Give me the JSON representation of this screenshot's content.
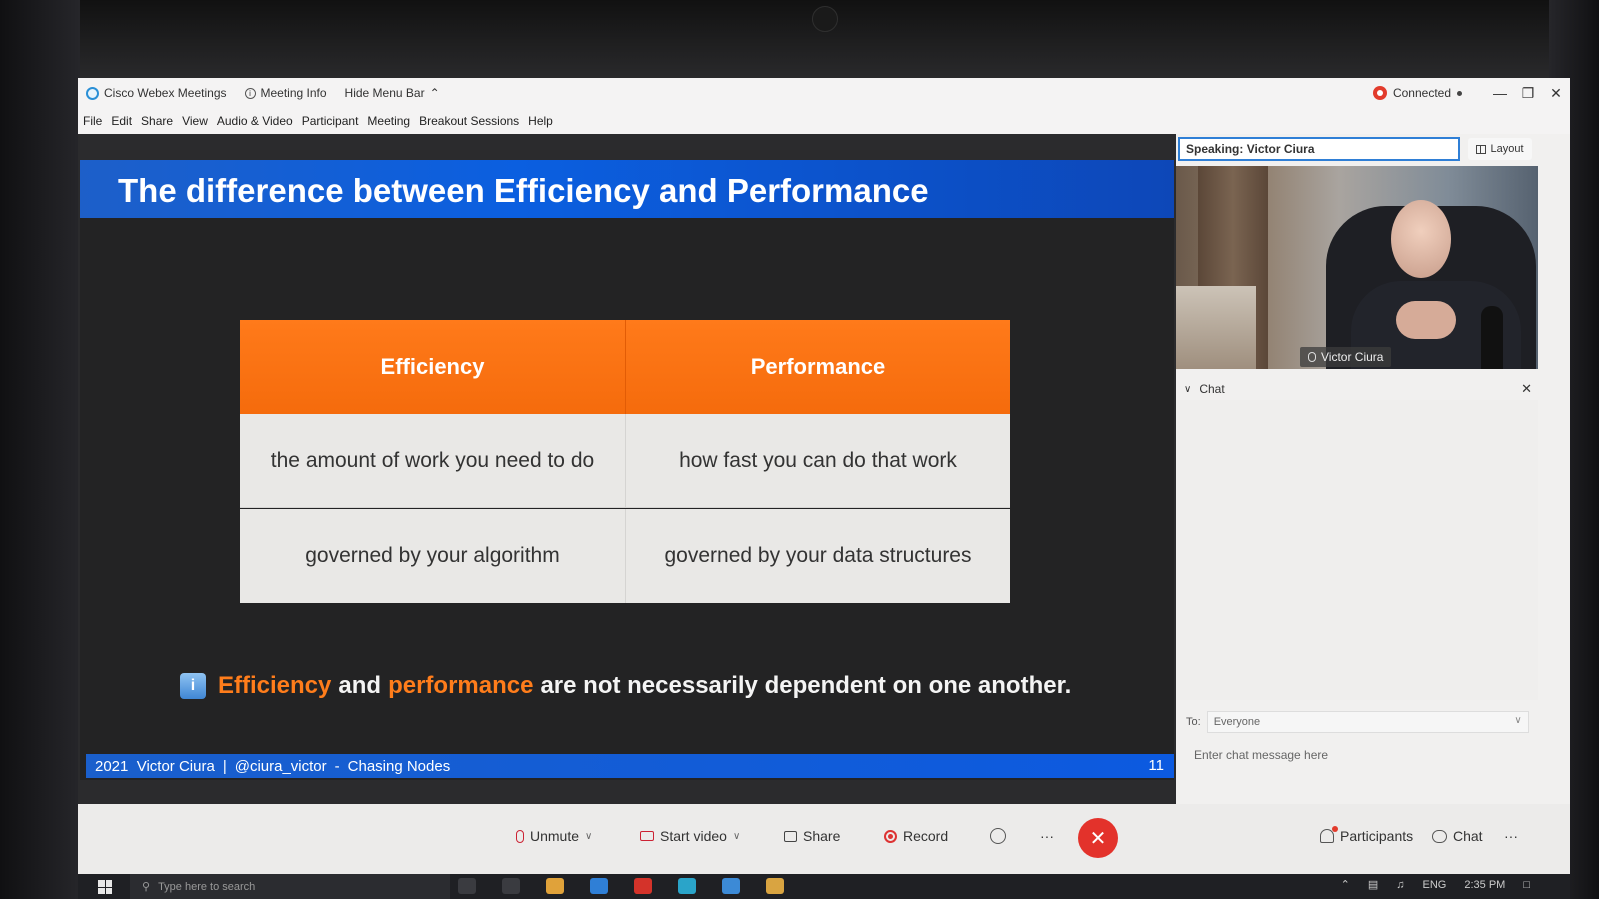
{
  "window": {
    "app_title": "Cisco Webex Meetings",
    "meeting_info": "Meeting Info",
    "hide_menu_bar": "Hide Menu Bar",
    "status": "Connected"
  },
  "menu": [
    "File",
    "Edit",
    "Share",
    "View",
    "Audio & Video",
    "Participant",
    "Meeting",
    "Breakout Sessions",
    "Help"
  ],
  "slide": {
    "title": "The difference between Efficiency and Performance",
    "table": {
      "headers": [
        "Efficiency",
        "Performance"
      ],
      "rows": [
        [
          "the amount of work you need to do",
          "how fast you can do that work"
        ],
        [
          "governed by your algorithm",
          "governed by your data structures"
        ]
      ]
    },
    "note": {
      "icon": "i",
      "word1": "Efficiency",
      "and": "and",
      "word2": "performance",
      "rest": "are not necessarily dependent on one another."
    },
    "footer": {
      "year": "2021",
      "author": "Victor Ciura",
      "sep1": "|",
      "handle": "@ciura_victor",
      "sep2": "-",
      "talk": "Chasing Nodes",
      "page": "11"
    }
  },
  "right_panel": {
    "speaking_label": "Speaking:",
    "speaking_name": "Victor Ciura",
    "layout_label": "Layout",
    "video_name": "Victor Ciura",
    "chat_title": "Chat",
    "to_label": "To:",
    "to_value": "Everyone",
    "chat_placeholder": "Enter chat message here"
  },
  "controls": {
    "unmute": "Unmute",
    "start_video": "Start video",
    "share": "Share",
    "record": "Record",
    "more": "···",
    "participants": "Participants",
    "chat": "Chat",
    "overflow": "···"
  },
  "taskbar": {
    "search_placeholder": "Type here to search",
    "lang": "ENG",
    "time": "2:35 PM"
  },
  "colors": {
    "accent_blue": "#0b5fe0",
    "table_orange": "#f56b0c",
    "end_call_red": "#e3322b"
  }
}
